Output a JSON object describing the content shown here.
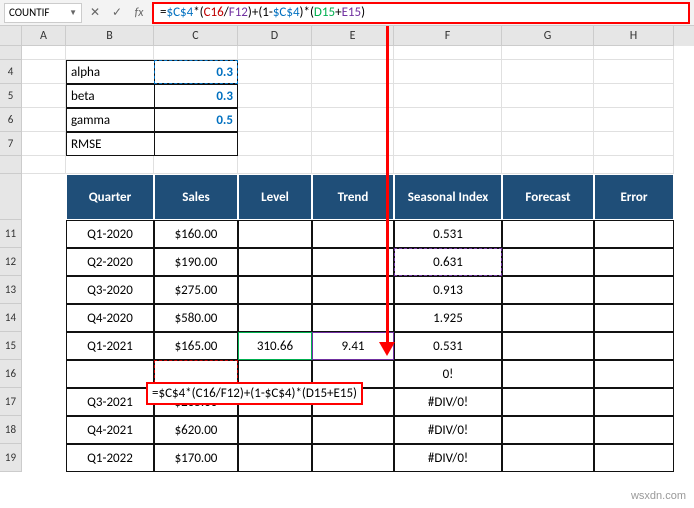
{
  "nameBox": "COUNTIF",
  "formulaBar": {
    "prefix": "=",
    "c4a": "$C$4",
    "s1": "*(",
    "c16": "C16",
    "s2": "/",
    "f12": "F12",
    "s3": ")+(1-",
    "c4b": "$C$4",
    "s4": ")*(",
    "d15": "D15",
    "s5": "+",
    "e15": "E15",
    "s6": ")"
  },
  "cols": [
    "A",
    "B",
    "C",
    "D",
    "E",
    "F",
    "G",
    "H"
  ],
  "params": {
    "alpha": {
      "label": "alpha",
      "value": "0.3"
    },
    "beta": {
      "label": "beta",
      "value": "0.3"
    },
    "gamma": {
      "label": "gamma",
      "value": "0.5"
    },
    "rmse": {
      "label": "RMSE",
      "value": ""
    }
  },
  "headers": {
    "quarter": "Quarter",
    "sales": "Sales",
    "level": "Level",
    "trend": "Trend",
    "seasonal": "Seasonal Index",
    "forecast": "Forecast",
    "error": "Error"
  },
  "rows": [
    {
      "r": "11",
      "q": "Q1-2020",
      "s": "$160.00",
      "lv": "",
      "tr": "",
      "si": "0.531"
    },
    {
      "r": "12",
      "q": "Q2-2020",
      "s": "$190.00",
      "lv": "",
      "tr": "",
      "si": "0.631"
    },
    {
      "r": "13",
      "q": "Q3-2020",
      "s": "$275.00",
      "lv": "",
      "tr": "",
      "si": "0.913"
    },
    {
      "r": "14",
      "q": "Q4-2020",
      "s": "$580.00",
      "lv": "",
      "tr": "",
      "si": "1.925"
    },
    {
      "r": "15",
      "q": "Q1-2021",
      "s": "$165.00",
      "lv": "310.66",
      "tr": "9.41",
      "si": "0.531"
    },
    {
      "r": "16",
      "q": "",
      "s": "",
      "lv": "",
      "tr": "",
      "si": "0!"
    },
    {
      "r": "17",
      "q": "Q3-2021",
      "s": "$285.00",
      "lv": "",
      "tr": "",
      "si": "#DIV/0!"
    },
    {
      "r": "18",
      "q": "Q4-2021",
      "s": "$620.00",
      "lv": "",
      "tr": "",
      "si": "#DIV/0!"
    },
    {
      "r": "19",
      "q": "Q1-2022",
      "s": "$170.00",
      "lv": "",
      "tr": "",
      "si": "#DIV/0!"
    }
  ],
  "inlineFormula": "=$C$4*(C16/F12)+(1-$C$4)*(D15+E15)",
  "watermark": "wsxdn.com",
  "fbIcons": {
    "cancel": "✕",
    "enter": "✓",
    "fx": "fx"
  }
}
